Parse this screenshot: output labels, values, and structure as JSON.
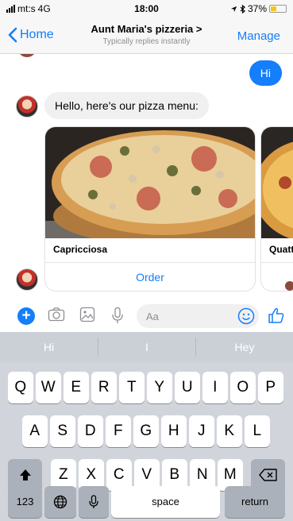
{
  "status": {
    "carrier": "mt:s",
    "network": "4G",
    "time": "18:00",
    "battery": "37%",
    "battery_level": 0.37
  },
  "nav": {
    "back_label": "Home",
    "title": "Aunt Maria's pizzeria >",
    "subtitle": "Typically replies instantly",
    "manage_label": "Manage"
  },
  "chat": {
    "outgoing": "Hi",
    "incoming": "Hello, here's our pizza menu:",
    "cards": [
      {
        "title": "Capricciosa",
        "button": "Order"
      },
      {
        "title": "Quatt"
      }
    ]
  },
  "composer": {
    "placeholder": "Aa"
  },
  "keyboard": {
    "suggestions": [
      "Hi",
      "I",
      "Hey"
    ],
    "row1": [
      "Q",
      "W",
      "E",
      "R",
      "T",
      "Y",
      "U",
      "I",
      "O",
      "P"
    ],
    "row2": [
      "A",
      "S",
      "D",
      "F",
      "G",
      "H",
      "J",
      "K",
      "L"
    ],
    "row3": [
      "Z",
      "X",
      "C",
      "V",
      "B",
      "N",
      "M"
    ],
    "numbers_label": "123",
    "space_label": "space",
    "return_label": "return"
  },
  "colors": {
    "accent": "#147efb",
    "bubble_in": "#f1f0f0",
    "keyboard_bg": "#d1d5db"
  }
}
